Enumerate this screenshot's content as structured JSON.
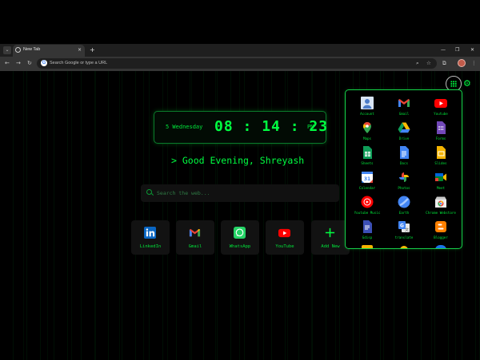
{
  "browser": {
    "tab_title": "New Tab",
    "tab_close": "×",
    "new_tab": "+",
    "window_controls": [
      "—",
      "❐",
      "✕"
    ],
    "nav": [
      "←",
      "→",
      "↻"
    ],
    "omnibox_placeholder": "Search Google or type a URL",
    "omnibox_icons": [
      "⌕",
      "☆",
      "⧉",
      "⋮"
    ]
  },
  "clock": {
    "date": "5 Wednesday",
    "hour": "08",
    "minute": "14",
    "second": "23",
    "ampm": "PM"
  },
  "greeting": "> Good Evening, Shreyash",
  "search": {
    "placeholder": "Search the web..."
  },
  "shortcuts": [
    {
      "label": "LinkedIn",
      "icon": "linkedin-icon"
    },
    {
      "label": "Gmail",
      "icon": "gmail-icon"
    },
    {
      "label": "WhatsApp",
      "icon": "whatsapp-icon"
    },
    {
      "label": "YouTube",
      "icon": "youtube-icon"
    },
    {
      "label": "Add New",
      "icon": "plus-icon"
    }
  ],
  "apps": [
    {
      "label": "Account",
      "icon": "account-icon"
    },
    {
      "label": "Gmail",
      "icon": "gmail-icon"
    },
    {
      "label": "Youtube",
      "icon": "youtube-icon"
    },
    {
      "label": "Maps",
      "icon": "maps-icon"
    },
    {
      "label": "Drive",
      "icon": "drive-icon"
    },
    {
      "label": "Forms",
      "icon": "forms-icon"
    },
    {
      "label": "Sheets",
      "icon": "sheets-icon"
    },
    {
      "label": "Docs",
      "icon": "docs-icon"
    },
    {
      "label": "Slides",
      "icon": "slides-icon"
    },
    {
      "label": "Calendar",
      "icon": "calendar-icon"
    },
    {
      "label": "Photos",
      "icon": "photos-icon"
    },
    {
      "label": "Meet",
      "icon": "meet-icon"
    },
    {
      "label": "Youtube Music",
      "icon": "youtube-music-icon"
    },
    {
      "label": "Earth",
      "icon": "earth-icon"
    },
    {
      "label": "Chrome Webstore",
      "icon": "chrome-webstore-icon"
    },
    {
      "label": "Gdisp",
      "icon": "gdisp-icon"
    },
    {
      "label": "translate",
      "icon": "translate-icon"
    },
    {
      "label": "Blogger",
      "icon": "blogger-icon"
    }
  ],
  "colors": {
    "accent": "#00ff41",
    "background": "#000000",
    "panel_border": "#16d14a"
  }
}
